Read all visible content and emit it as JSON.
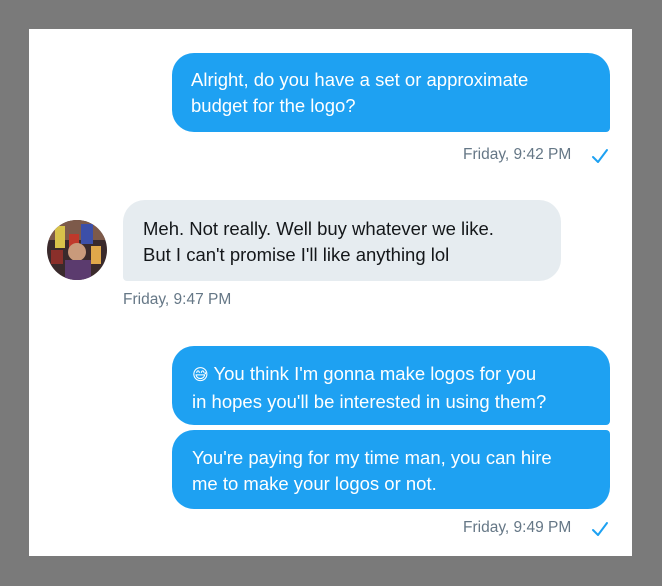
{
  "conversation": {
    "messages": [
      {
        "direction": "outgoing",
        "lines": [
          "Alright, do you have a set or approximate",
          "budget for the logo?"
        ]
      },
      {
        "direction": "incoming",
        "lines": [
          "Meh. Not really. Well buy whatever we like.",
          "But I can't promise I'll like anything lol"
        ]
      },
      {
        "direction": "outgoing",
        "emoji": "😅",
        "lines": [
          "You think I'm gonna make logos for you",
          "in hopes you'll be interested in using them?"
        ]
      },
      {
        "direction": "outgoing",
        "lines": [
          "You're paying for my time man, you can hire",
          "me to make your logos or not."
        ]
      }
    ],
    "timestamps": [
      "Friday, 9:42 PM",
      "Friday, 9:47 PM",
      "Friday, 9:49 PM"
    ]
  },
  "icons": {
    "read_receipt": "checkmark-icon",
    "avatar": "user-avatar",
    "emoji": "grinning-sweat-emoji"
  },
  "colors": {
    "outgoing_bubble": "#1ea1f2",
    "incoming_bubble": "#e6ecf0",
    "timestamp": "#657786",
    "check": "#1da1f2"
  }
}
